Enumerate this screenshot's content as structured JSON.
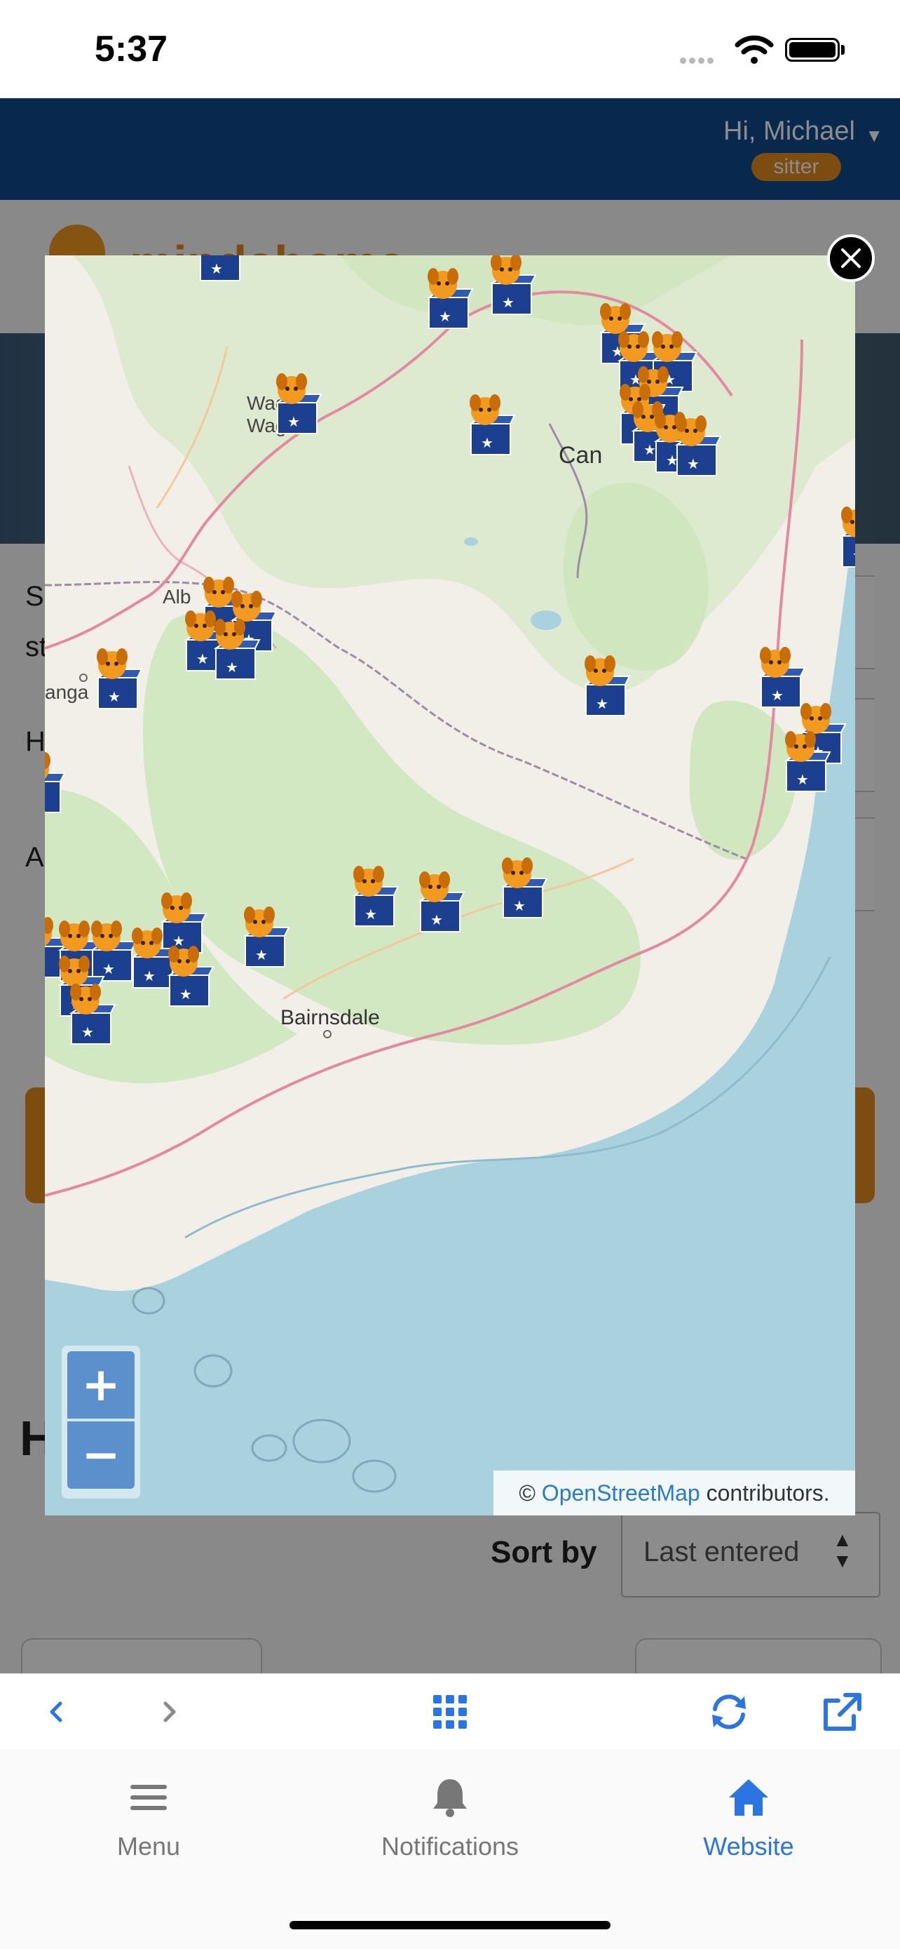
{
  "status_bar": {
    "time": "5:37"
  },
  "header": {
    "greeting": "Hi, Michael",
    "role_badge": "sitter"
  },
  "page": {
    "logo_text": "mindahome",
    "side_texts": [
      "S",
      "st",
      "H",
      "A"
    ],
    "heading": "H",
    "sort_label": "Sort by",
    "sort_value": "Last entered"
  },
  "map": {
    "labels": {
      "wagga_1": "Wag",
      "wagga_2": "Wag",
      "canberra": "Can",
      "albury": "Alb",
      "wangaratta": "anga",
      "bairnsdale": "Bairnsdale"
    },
    "marker_icon": "house-sitting-marker-icon",
    "zoom_in_label": "+",
    "zoom_out_label": "−",
    "attribution_prefix": "©",
    "attribution_link": "OpenStreetMap",
    "attribution_suffix": "contributors.",
    "colors": {
      "sea": "#a9d1de",
      "land": "#f2efe9",
      "forest": "#cde6bb",
      "marker_box": "#1c3f8f",
      "marker_dog": "#f29a1f",
      "zoom_button": "#5b90cc"
    }
  },
  "browser_toolbar": {
    "icons": [
      "back-icon",
      "forward-icon",
      "grid-icon",
      "refresh-icon",
      "open-external-icon"
    ],
    "accent": "#2a75e0"
  },
  "tabs": [
    {
      "label": "Menu",
      "icon": "menu-icon",
      "active": false
    },
    {
      "label": "Notifications",
      "icon": "bell-icon",
      "active": false
    },
    {
      "label": "Website",
      "icon": "home-icon",
      "active": true
    }
  ]
}
